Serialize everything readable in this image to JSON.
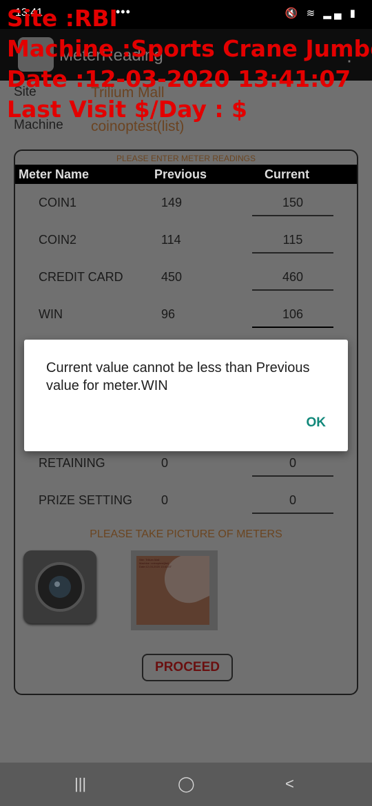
{
  "status_bar": {
    "time": "13:41",
    "dots": "•••",
    "icons": "🔇 ≋ ▂▄ ▮"
  },
  "app_bar": {
    "title": "MeterReading",
    "menu_icon": "⋮"
  },
  "overlay": {
    "site": "Site :RBI",
    "machine": "Machine :Sports Crane Jumbo(",
    "date": "Date :12-03-2020 13:41:07",
    "last_visit": "Last Visit $/Day : $"
  },
  "info": {
    "site_label": "Site",
    "site_value": "Trilium Mall",
    "machine_label": "Machine",
    "machine_value": "coinoptest(list)"
  },
  "panel": {
    "title": "PLEASE ENTER METER READINGS",
    "headers": {
      "name": "Meter Name",
      "previous": "Previous",
      "current": "Current"
    },
    "rows": [
      {
        "name": "COIN1",
        "previous": "149",
        "current": "150"
      },
      {
        "name": "COIN2",
        "previous": "114",
        "current": "115"
      },
      {
        "name": "CREDIT CARD",
        "previous": "450",
        "current": "460"
      },
      {
        "name": "WIN",
        "previous": "96",
        "current": "106"
      },
      {
        "name": "RETAINING",
        "previous": "0",
        "current": "0"
      },
      {
        "name": "PRIZE SETTING",
        "previous": "0",
        "current": "0"
      }
    ],
    "picture_label": "PLEASE TAKE PICTURE OF METERS",
    "thumbnail_text": "Site: Trilium Mall\nMachine :coinoptest(list)\nDate:12-03-2020 13:41:07",
    "proceed_label": "PROCEED"
  },
  "dialog": {
    "message": "Current value cannot be less than Previous value for meter.WIN",
    "ok_label": "OK"
  },
  "nav_bar": {
    "recents_icon": "|||",
    "home_icon": "◯",
    "back_icon": "<"
  },
  "colors": {
    "overlay_red": "#e30000",
    "dialog_accent": "#11887a",
    "proceed_text": "#6a0f0f"
  }
}
